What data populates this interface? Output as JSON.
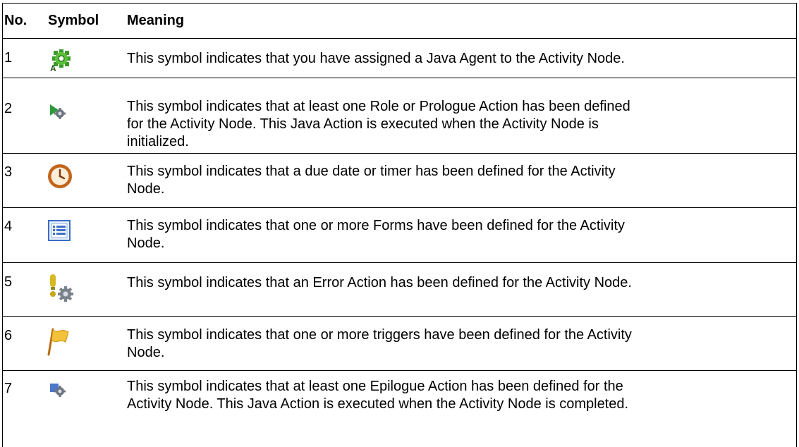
{
  "header": {
    "no": "No.",
    "symbol": "Symbol",
    "meaning": "Meaning"
  },
  "rows": [
    {
      "no": "1",
      "icon": "java-agent-gear-icon",
      "lines": [
        "This symbol indicates that you have assigned a Java Agent to the Activity Node."
      ]
    },
    {
      "no": "2",
      "icon": "prologue-action-icon",
      "lines": [
        "This symbol indicates that at least one Role or Prologue Action has been defined",
        "for the Activity Node. This Java Action is executed when the Activity Node is",
        "initialized."
      ]
    },
    {
      "no": "3",
      "icon": "timer-clock-icon",
      "lines": [
        "This symbol indicates that a due date or timer has been defined for the Activity",
        "Node."
      ]
    },
    {
      "no": "4",
      "icon": "form-list-icon",
      "lines": [
        "This symbol indicates that one or more Forms have been defined for the Activity",
        "Node."
      ]
    },
    {
      "no": "5",
      "icon": "error-action-icon",
      "lines": [
        "This symbol indicates that an Error Action has been defined for the Activity Node."
      ]
    },
    {
      "no": "6",
      "icon": "trigger-flag-icon",
      "lines": [
        "This symbol indicates that one or more triggers have been defined for the Activity",
        "Node."
      ]
    },
    {
      "no": "7",
      "icon": "epilogue-action-icon",
      "lines": [
        "This symbol indicates that at least one Epilogue Action has been defined for the",
        "Activity Node. This Java Action is executed when the Activity Node is completed."
      ]
    }
  ]
}
